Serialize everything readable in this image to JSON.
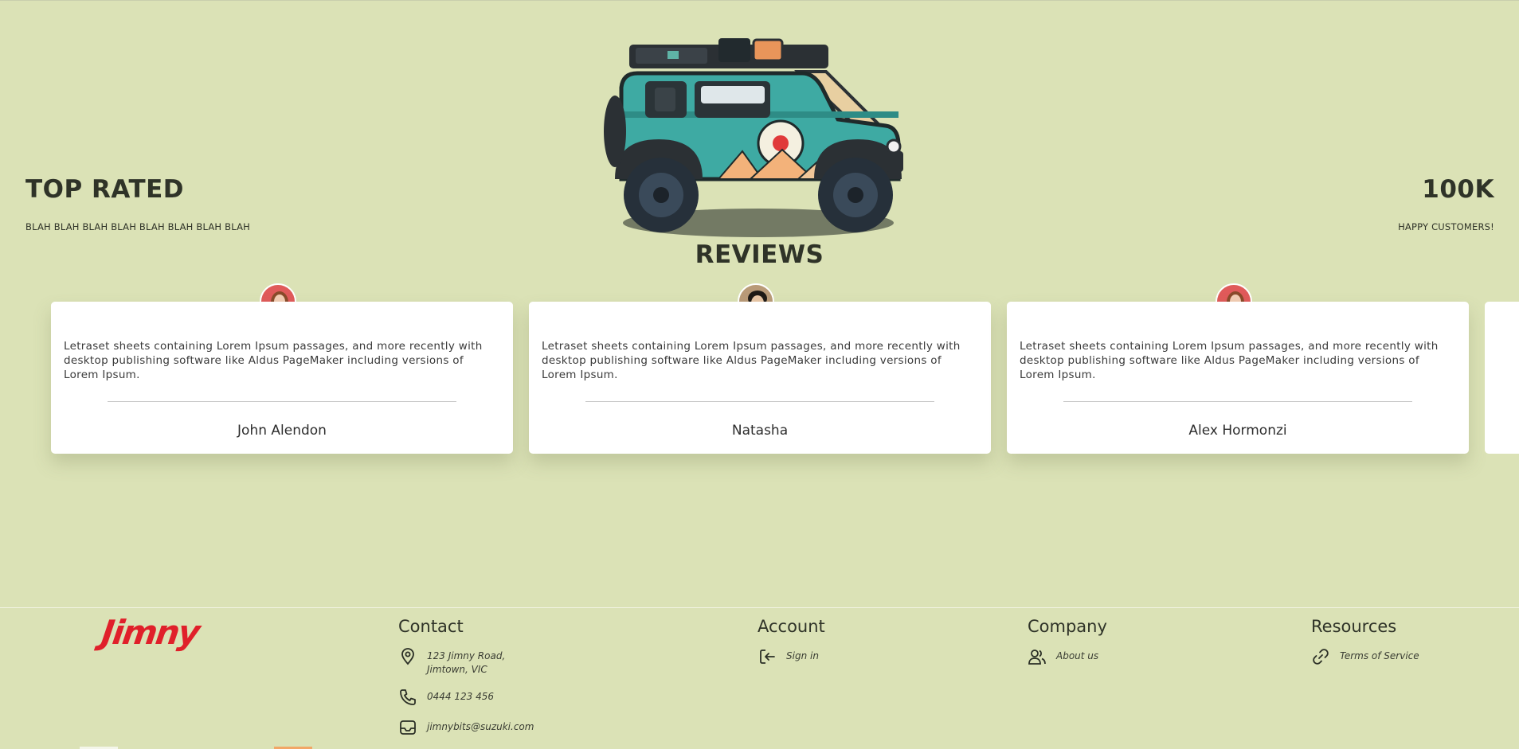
{
  "hero": {
    "left_title": "TOP RATED",
    "left_subtitle": "BLAH BLAH BLAH BLAH BLAH BLAH BLAH BLAH",
    "right_title": "100K",
    "right_subtitle": "HAPPY CUSTOMERS!"
  },
  "reviews": {
    "title": "REVIEWS",
    "items": [
      {
        "text": "Letraset sheets containing Lorem Ipsum passages, and more recently with desktop publishing software like Aldus PageMaker including versions of Lorem Ipsum.",
        "name": "John Alendon",
        "avatar": "woman-avatar"
      },
      {
        "text": "Letraset sheets containing Lorem Ipsum passages, and more recently with desktop publishing software like Aldus PageMaker including versions of Lorem Ipsum.",
        "name": "Natasha",
        "avatar": "man-avatar"
      },
      {
        "text": "Letraset sheets containing Lorem Ipsum passages, and more recently with desktop publishing software like Aldus PageMaker including versions of Lorem Ipsum.",
        "name": "Alex Hormonzi",
        "avatar": "woman-avatar"
      }
    ]
  },
  "footer": {
    "logo": "Jimny",
    "contact": {
      "heading": "Contact",
      "address": "123 Jimny Road, Jimtown, VIC",
      "phone": "0444 123 456",
      "email": "jimnybits@suzuki.com"
    },
    "account": {
      "heading": "Account",
      "sign_in": "Sign in"
    },
    "company": {
      "heading": "Company",
      "about": "About us"
    },
    "resources": {
      "heading": "Resources",
      "terms": "Terms of Service"
    }
  },
  "colors": {
    "background": "#dbe2b6",
    "brand_red": "#e0202a",
    "card": "#ffffff"
  },
  "icons": [
    "location-pin-icon",
    "phone-icon",
    "mail-icon",
    "sign-in-icon",
    "users-icon",
    "link-icon"
  ]
}
